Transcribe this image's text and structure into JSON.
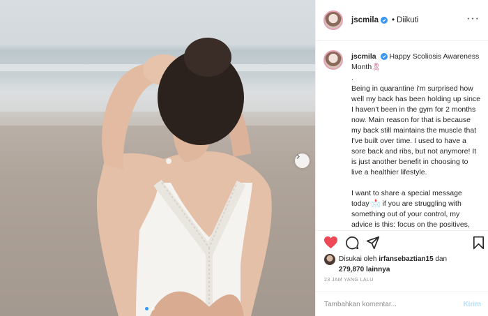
{
  "post": {
    "username": "jscmila",
    "follow_status": "Diikuti",
    "follow_separator": "•"
  },
  "caption": {
    "username": "jscmila",
    "first_line": "Happy Scoliosis Awareness Month",
    "ribbon_emoji": "🎗",
    "body": ".\nBeing in quarantine i'm surprised how well my back has been holding up since I haven't been in the gym for 2 months now. Main reason for that is because my back still maintains the muscle that I've built over time. I used to have a sore back and ribs, but not anymore! It is just another benefit in choosing to live a healthier lifestyle.\n\nI want to share a special message today 📩 if you are struggling with something out of your control, my advice is this: focus on the positives, focus on what u can do, keep trying, and never give up ❤️"
  },
  "likes": {
    "liked_by_prefix": "Disukai oleh",
    "liked_by_user": "irfansebaztian15",
    "and_word": "dan",
    "count": "279,870",
    "others_word": "lainnya"
  },
  "timestamp": "23 JAM YANG LALU",
  "comment": {
    "placeholder": "Tambahkan komentar...",
    "send_label": "Kirim"
  },
  "carousel": {
    "total": 2,
    "active_index": 0
  },
  "colors": {
    "like_red": "#ed4956",
    "verified_blue": "#3897f0",
    "send_disabled": "#b2dffc",
    "meta_gray": "#8e8e8e"
  },
  "icons": [
    "more-options-icon",
    "verified-badge-icon",
    "heart-icon",
    "comment-icon",
    "share-icon",
    "bookmark-icon",
    "next-arrow-icon"
  ]
}
